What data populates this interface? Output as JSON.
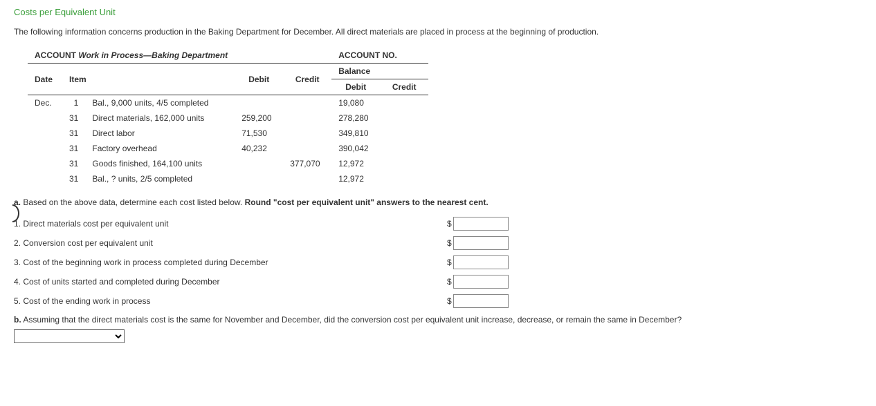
{
  "title": "Costs per Equivalent Unit",
  "intro": "The following information concerns production in the Baking Department for December. All direct materials are placed in process at the beginning of production.",
  "account": {
    "label_account": "ACCOUNT",
    "account_name": "Work in Process—Baking Department",
    "label_account_no": "ACCOUNT NO.",
    "headers": {
      "date": "Date",
      "item": "Item",
      "debit": "Debit",
      "credit": "Credit",
      "balance": "Balance",
      "bdebit": "Debit",
      "bcredit": "Credit"
    },
    "rows": [
      {
        "date": "Dec.",
        "day": "1",
        "item": "Bal., 9,000 units, 4/5 completed",
        "debit": "",
        "credit": "",
        "bdebit": "19,080",
        "bcredit": ""
      },
      {
        "date": "",
        "day": "31",
        "item": "Direct materials, 162,000 units",
        "debit": "259,200",
        "credit": "",
        "bdebit": "278,280",
        "bcredit": ""
      },
      {
        "date": "",
        "day": "31",
        "item": "Direct labor",
        "debit": "71,530",
        "credit": "",
        "bdebit": "349,810",
        "bcredit": ""
      },
      {
        "date": "",
        "day": "31",
        "item": "Factory overhead",
        "debit": "40,232",
        "credit": "",
        "bdebit": "390,042",
        "bcredit": ""
      },
      {
        "date": "",
        "day": "31",
        "item": "Goods finished, 164,100 units",
        "debit": "",
        "credit": "377,070",
        "bdebit": "12,972",
        "bcredit": ""
      },
      {
        "date": "",
        "day": "31",
        "item": "Bal., ? units, 2/5 completed",
        "debit": "",
        "credit": "",
        "bdebit": "12,972",
        "bcredit": ""
      }
    ]
  },
  "part_a": {
    "label": "a.",
    "text_before": "Based on the above data, determine each cost listed below. ",
    "bold": "Round \"cost per equivalent unit\" answers to the nearest cent.",
    "items": [
      {
        "num": "1.",
        "label": "Direct materials cost per equivalent unit"
      },
      {
        "num": "2.",
        "label": "Conversion cost per equivalent unit"
      },
      {
        "num": "3.",
        "label": "Cost of the beginning work in process completed during December"
      },
      {
        "num": "4.",
        "label": "Cost of units started and completed during December"
      },
      {
        "num": "5.",
        "label": "Cost of the ending work in process"
      }
    ],
    "dollar": "$"
  },
  "part_b": {
    "label": "b.",
    "text": "Assuming that the direct materials cost is the same for November and December, did the conversion cost per equivalent unit increase, decrease, or remain the same in December?"
  }
}
